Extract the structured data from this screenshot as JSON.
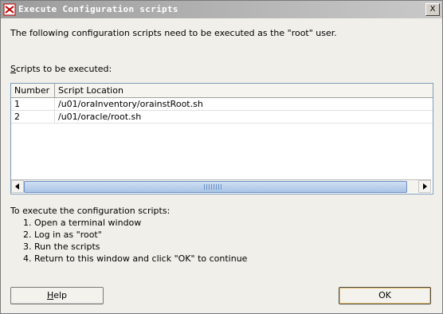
{
  "window": {
    "title": "Execute Configuration scripts",
    "close_label": "X"
  },
  "intro_text": "The following configuration scripts need to be executed as the \"root\" user.",
  "scripts_label": {
    "mnemonic": "S",
    "rest": "cripts to be executed:"
  },
  "table": {
    "columns": [
      "Number",
      "Script Location"
    ],
    "rows": [
      {
        "number": "1",
        "location": "/u01/oraInventory/orainstRoot.sh"
      },
      {
        "number": "2",
        "location": "/u01/oracle/root.sh"
      }
    ]
  },
  "instructions": {
    "heading": "To execute the configuration scripts:",
    "steps": [
      "1. Open a terminal window",
      "2. Log in as \"root\"",
      "3. Run the scripts",
      "4. Return to this window and click \"OK\" to continue"
    ]
  },
  "buttons": {
    "help": {
      "mnemonic": "H",
      "rest": "elp"
    },
    "ok": "OK"
  }
}
